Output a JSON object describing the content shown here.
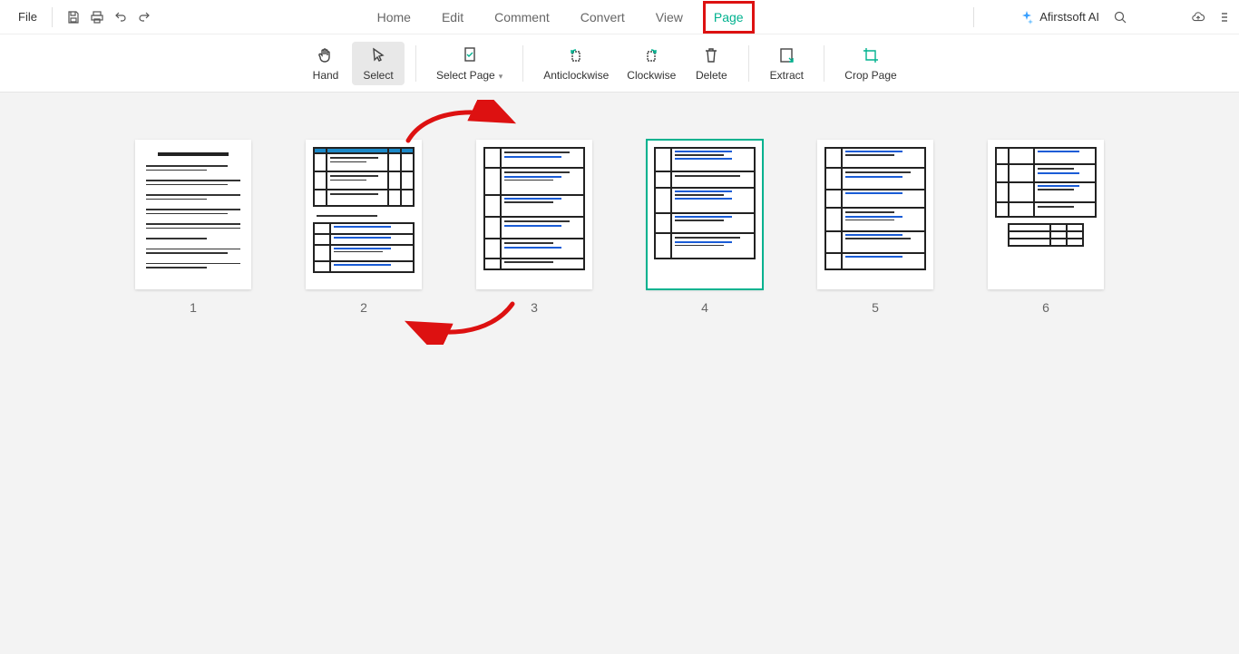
{
  "topbar": {
    "file_label": "File"
  },
  "menu": {
    "home": "Home",
    "edit": "Edit",
    "comment": "Comment",
    "convert": "Convert",
    "view": "View",
    "page": "Page"
  },
  "ai": {
    "label": "Afirstsoft AI"
  },
  "ribbon": {
    "hand": "Hand",
    "select": "Select",
    "select_page": "Select Page",
    "anticlockwise": "Anticlockwise",
    "clockwise": "Clockwise",
    "delete": "Delete",
    "extract": "Extract",
    "crop_page": "Crop Page"
  },
  "pages": {
    "p1": "1",
    "p2": "2",
    "p3": "3",
    "p4": "4",
    "p5": "5",
    "p6": "6"
  }
}
